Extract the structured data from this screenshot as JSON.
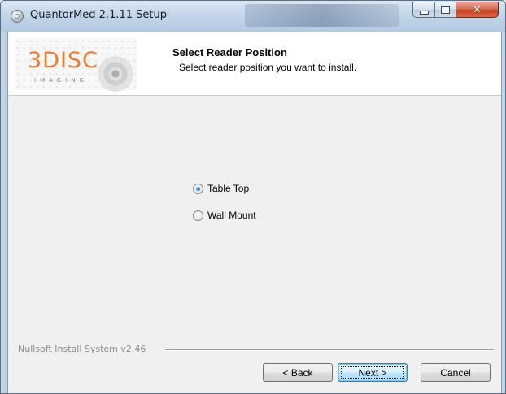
{
  "window": {
    "title": "QuantorMed 2.1.11 Setup"
  },
  "header": {
    "logo_text": "3DISC",
    "logo_subtext": "IMAGING",
    "title": "Select Reader Position",
    "subtitle": "Select reader position you want to install."
  },
  "options": [
    {
      "label": "Table Top",
      "selected": true
    },
    {
      "label": "Wall Mount",
      "selected": false
    }
  ],
  "footer": {
    "branding": "Nullsoft Install System v2.46",
    "back_label": "< Back",
    "next_label": "Next >",
    "cancel_label": "Cancel"
  },
  "colors": {
    "logo_orange": "#f47a2c",
    "close_red": "#c2401f",
    "default_button_blue": "#3c7fb1"
  },
  "icons": {
    "app": "setup-disc-icon",
    "minimize": "minimize-icon",
    "maximize": "maximize-icon",
    "close": "close-icon"
  }
}
